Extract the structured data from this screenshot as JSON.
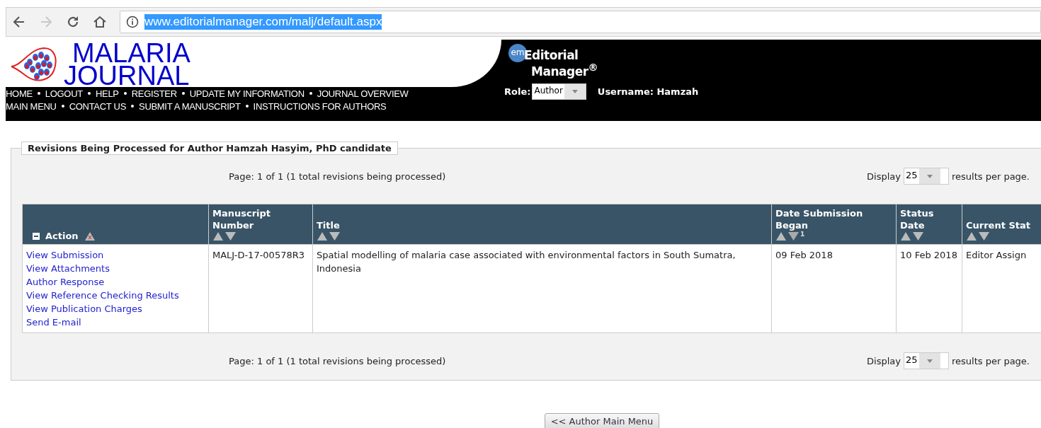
{
  "browser": {
    "url": "www.editorialmanager.com/malj/default.aspx",
    "forward_disabled": true
  },
  "header": {
    "journal_lines": [
      "MALARIA",
      "JOURNAL"
    ],
    "em_badge": "em",
    "em_lines": [
      "Editorial",
      "Manager$^{®}$"
    ],
    "nav_rows": [
      [
        "HOME",
        "LOGOUT",
        "HELP",
        "REGISTER",
        "UPDATE MY INFORMATION",
        "JOURNAL OVERVIEW"
      ],
      [
        "MAIN MENU",
        "CONTACT US",
        "SUBMIT A MANUSCRIPT",
        "INSTRUCTIONS FOR AUTHORS"
      ]
    ],
    "role_label": "Role:",
    "role_value": "Author",
    "username": "Username: Hamzah"
  },
  "panel": {
    "legend": "Revisions Being Processed for Author Hamzah Hasyim, PhD candidate",
    "pagers": [
      {
        "page_info": "Page: 1 of 1 (1 total revisions being processed)",
        "display_label": "Display",
        "value": "25",
        "suffix": "results per page."
      },
      {
        "page_info": "Page: 1 of 1 (1 total revisions being processed)",
        "display_label": "Display",
        "value": "25",
        "suffix": "results per page."
      }
    ],
    "table": {
      "columns": [
        {
          "kind": "action",
          "label": "Action"
        },
        {
          "kind": "sortable",
          "label": "Manuscript Number"
        },
        {
          "kind": "sortable",
          "label": "Title"
        },
        {
          "kind": "sortable",
          "label": "Date Submission Began",
          "sort_rank": "1"
        },
        {
          "kind": "sortable",
          "label": "Status Date"
        },
        {
          "kind": "sortable",
          "label": "Current Stat"
        }
      ],
      "rows": [
        {
          "cells": [
            [
              "View Submission",
              "View Attachments",
              "Author Response",
              "View Reference Checking Results",
              "View Publication Charges",
              "Send E-mail"
            ],
            "MALJ-D-17-00578R3",
            "Spatial modelling of malaria case associated with environmental factors in South Sumatra, Indonesia",
            "09 Feb 2018",
            "10 Feb 2018",
            "Editor Assign"
          ]
        }
      ]
    }
  },
  "footer_button": "<< Author Main Menu"
}
